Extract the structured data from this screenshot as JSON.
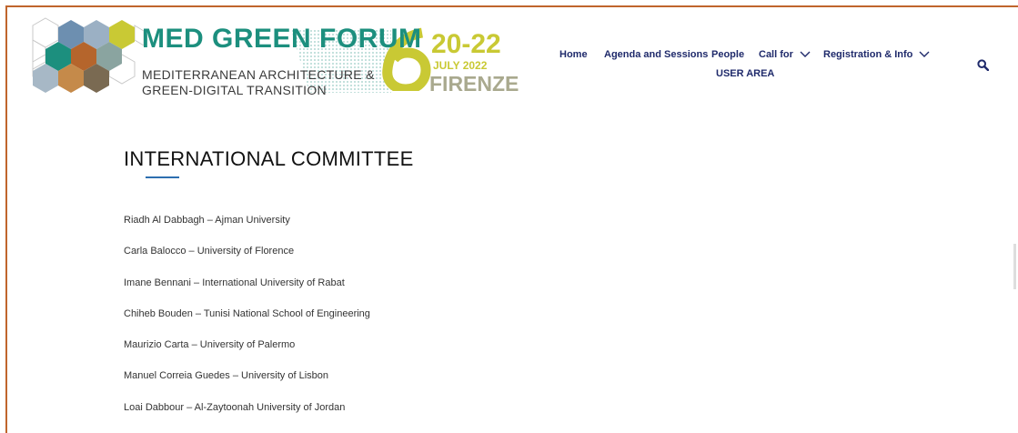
{
  "logo": {
    "title": "MED GREEN FORUM",
    "subtitle_line1": "MEDITERRANEAN ARCHITECTURE &",
    "subtitle_line2": "GREEN-DIGITAL TRANSITION",
    "dates": "20-22",
    "month_year": "JULY 2022",
    "city": "FIRENZE"
  },
  "nav": {
    "items": [
      {
        "label": "Home",
        "icon": null
      },
      {
        "label": "Agenda and Sessions",
        "icon": null
      },
      {
        "label": "People",
        "icon": null
      },
      {
        "label": "Call for",
        "icon": "chevron-down-icon"
      },
      {
        "label": "Registration & Info",
        "icon": "chevron-down-icon"
      }
    ],
    "user_area": "USER AREA",
    "search_icon": "search-icon"
  },
  "colors": {
    "brand_teal": "#1c8f7e",
    "brand_lime": "#c9c934",
    "nav_text": "#1f2a6b",
    "accent_underline": "#2d6fb0",
    "frame_border": "#c0652c"
  },
  "page": {
    "title": "INTERNATIONAL COMMITTEE",
    "members": [
      "Riadh Al Dabbagh – Ajman University",
      "Carla Balocco – University of Florence",
      "Imane Bennani – International University of Rabat",
      "Chiheb Bouden – Tunisi National School of Engineering",
      "Maurizio Carta – University of Palermo",
      "Manuel Correia Guedes – University of Lisbon",
      "Loai Dabbour – Al-Zaytoonah University of Jordan"
    ]
  }
}
